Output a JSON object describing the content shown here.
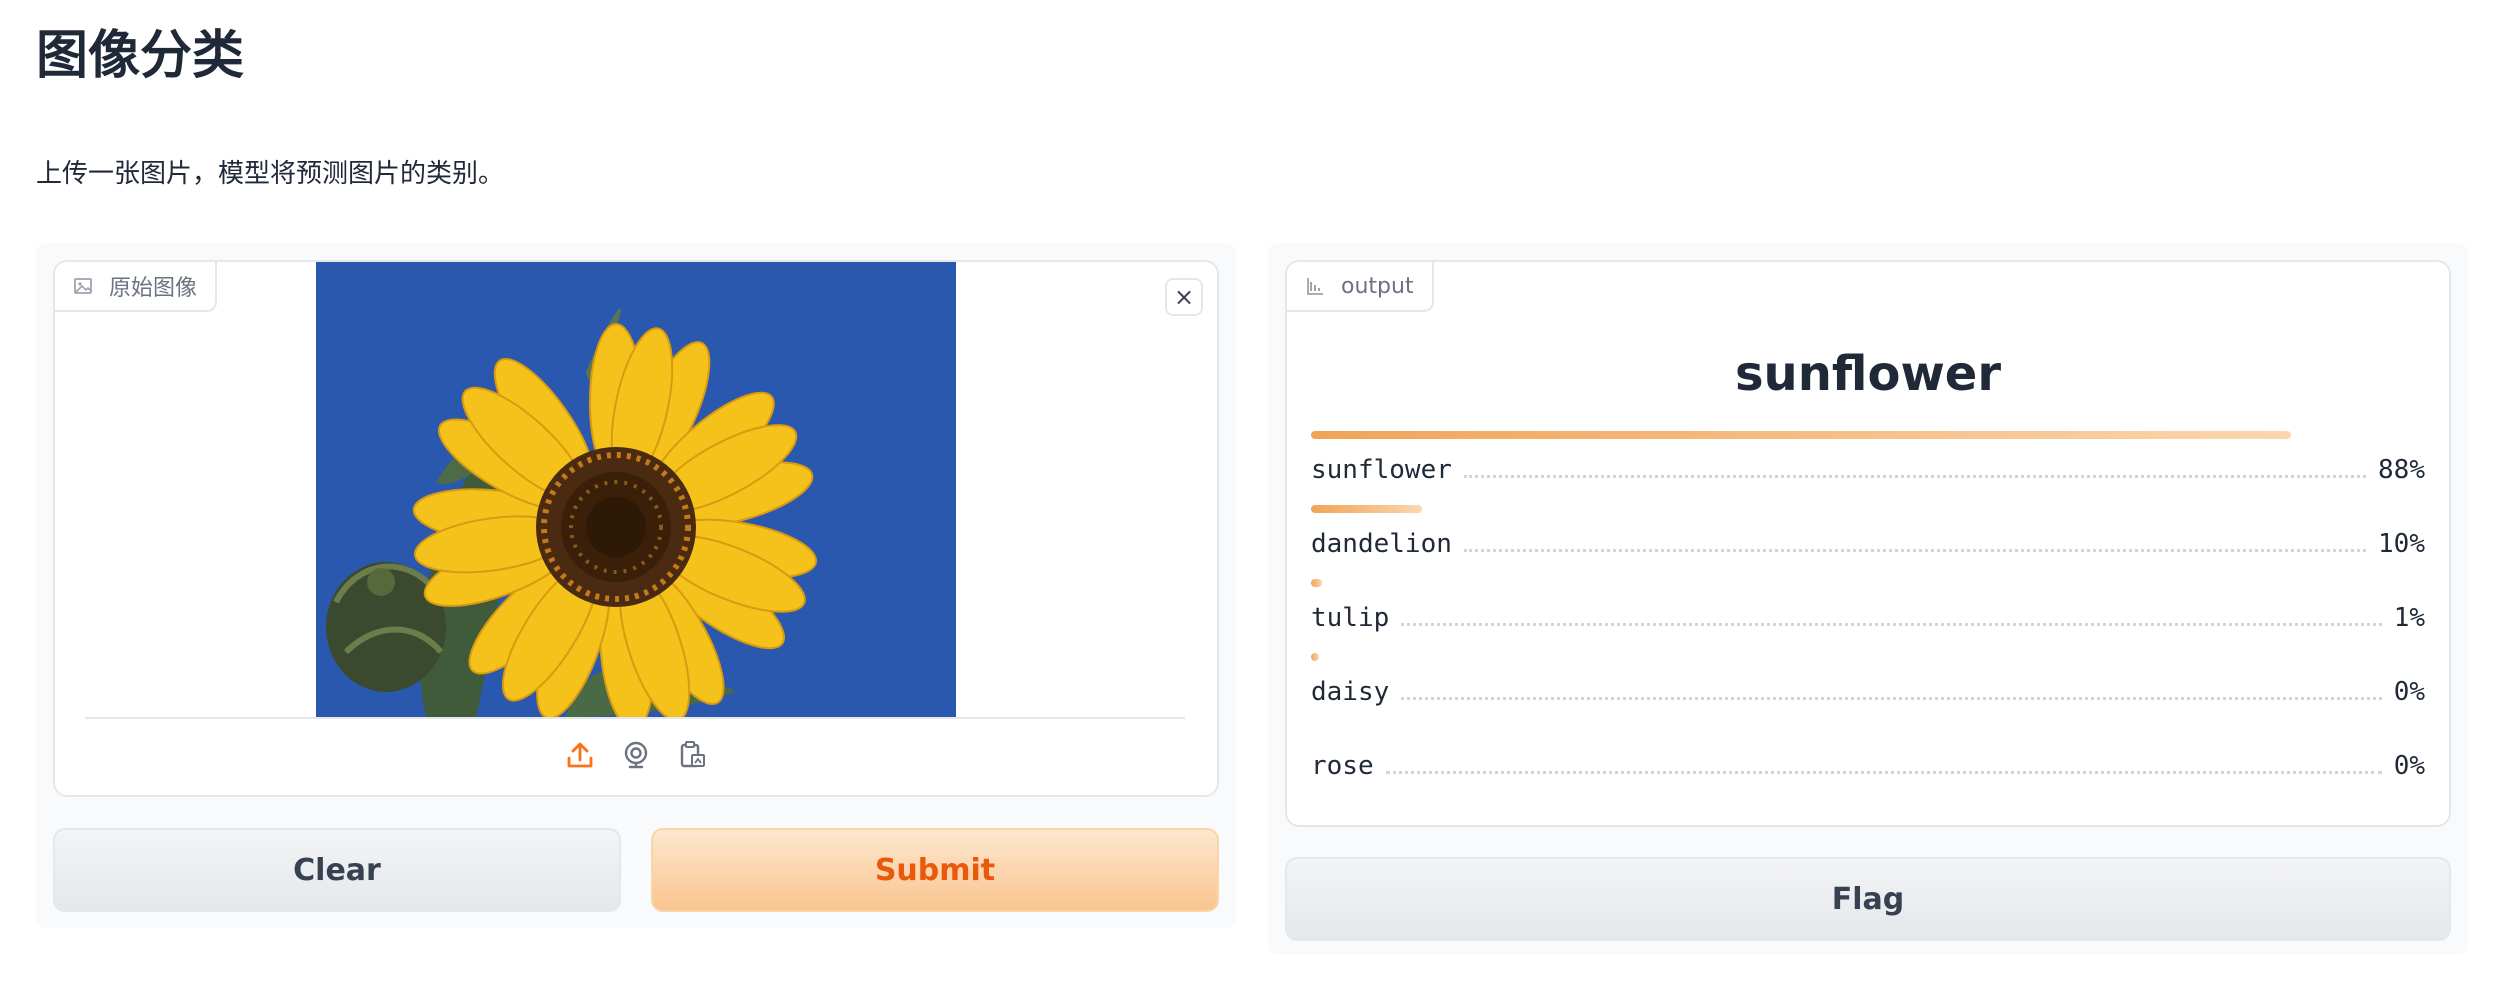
{
  "page": {
    "title": "图像分类",
    "description": "上传一张图片，模型将预测图片的类别。"
  },
  "input_panel": {
    "label": "原始图像",
    "label_icon": "image-icon",
    "close_symbol": "×",
    "close_icon": "close-icon",
    "image_subject": "sunflower",
    "source_icons": [
      "upload-icon",
      "webcam-icon",
      "clipboard-icon"
    ]
  },
  "buttons": {
    "clear": "Clear",
    "submit": "Submit",
    "flag": "Flag"
  },
  "output_panel": {
    "label": "output",
    "label_icon": "chart-icon",
    "top_label": "sunflower",
    "confidences": [
      {
        "label": "sunflower",
        "value": 0.88,
        "display": "88%"
      },
      {
        "label": "dandelion",
        "value": 0.1,
        "display": "10%"
      },
      {
        "label": "tulip",
        "value": 0.01,
        "display": "1%"
      },
      {
        "label": "daisy",
        "value": 0.004,
        "display": "0%"
      },
      {
        "label": "rose",
        "value": 0.0,
        "display": "0%"
      }
    ]
  },
  "colors": {
    "accent": "#f0a458",
    "submit_text": "#ea580c",
    "sky": "#2a58ae",
    "petal": "#f5c21b"
  }
}
